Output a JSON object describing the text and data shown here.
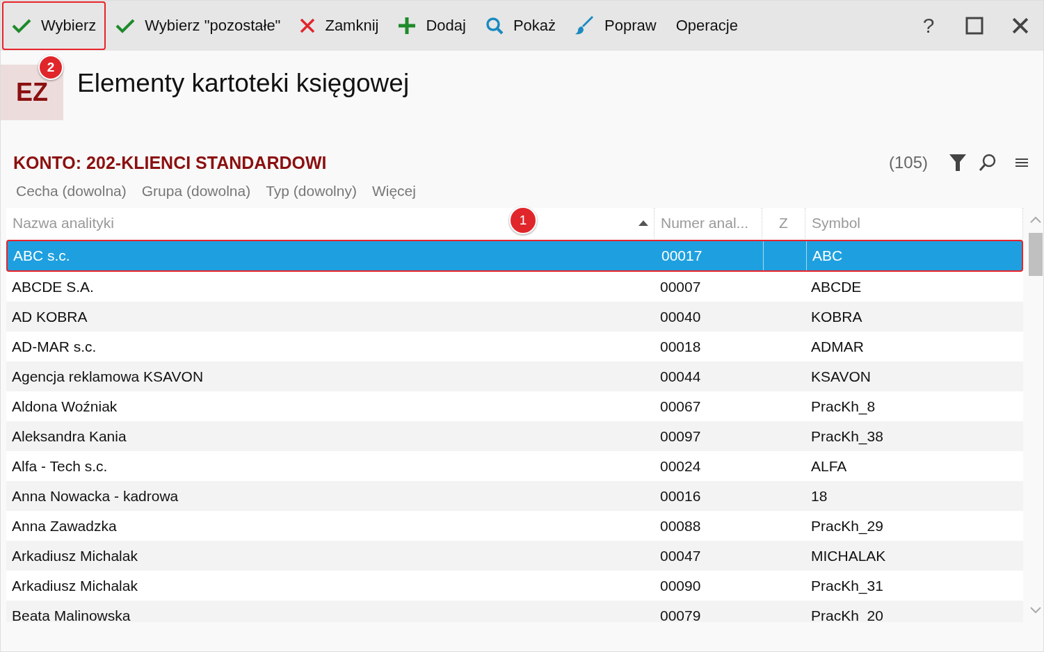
{
  "toolbar": {
    "buttons": [
      {
        "kind": "check",
        "label": "Wybierz",
        "highlighted": true
      },
      {
        "kind": "check",
        "label": "Wybierz \"pozostałe\"",
        "highlighted": false
      },
      {
        "kind": "close",
        "label": "Zamknij",
        "highlighted": false
      },
      {
        "kind": "add",
        "label": "Dodaj",
        "highlighted": false
      },
      {
        "kind": "search",
        "label": "Pokaż",
        "highlighted": false
      },
      {
        "kind": "brush",
        "label": "Popraw",
        "highlighted": false
      },
      {
        "kind": "none",
        "label": "Operacje",
        "highlighted": false
      }
    ],
    "window_controls": [
      {
        "kind": "help",
        "label": "?"
      },
      {
        "kind": "maximize"
      },
      {
        "kind": "close"
      }
    ]
  },
  "header": {
    "logo": "EZ",
    "title": "Elementy kartoteki księgowej",
    "badge": "2"
  },
  "section": {
    "heading": "KONTO: 202-KLIENCI STANDARDOWI",
    "count": "(105)",
    "filters": [
      "Cecha (dowolna)",
      "Grupa (dowolna)",
      "Typ (dowolny)",
      "Więcej"
    ]
  },
  "table": {
    "columns": [
      {
        "label": "Nazwa analityki",
        "sorted": true,
        "badge": "1"
      },
      {
        "label": "Numer anal..."
      },
      {
        "label": "Z"
      },
      {
        "label": "Symbol"
      }
    ],
    "rows": [
      {
        "cells": [
          "ABC s.c.",
          "00017",
          "",
          "ABC"
        ],
        "selected": true
      },
      {
        "cells": [
          "ABCDE S.A.",
          "00007",
          "",
          "ABCDE"
        ],
        "selected": false
      },
      {
        "cells": [
          "AD KOBRA",
          "00040",
          "",
          "KOBRA"
        ],
        "selected": false
      },
      {
        "cells": [
          "AD-MAR s.c.",
          "00018",
          "",
          "ADMAR"
        ],
        "selected": false
      },
      {
        "cells": [
          "Agencja reklamowa KSAVON",
          "00044",
          "",
          "KSAVON"
        ],
        "selected": false
      },
      {
        "cells": [
          "Aldona Woźniak",
          "00067",
          "",
          "PracKh_8"
        ],
        "selected": false
      },
      {
        "cells": [
          "Aleksandra Kania",
          "00097",
          "",
          "PracKh_38"
        ],
        "selected": false
      },
      {
        "cells": [
          "Alfa - Tech s.c.",
          "00024",
          "",
          "ALFA"
        ],
        "selected": false
      },
      {
        "cells": [
          "Anna Nowacka - kadrowa",
          "00016",
          "",
          "18"
        ],
        "selected": false
      },
      {
        "cells": [
          "Anna Zawadzka",
          "00088",
          "",
          "PracKh_29"
        ],
        "selected": false
      },
      {
        "cells": [
          "Arkadiusz Michalak",
          "00047",
          "",
          "MICHALAK"
        ],
        "selected": false
      },
      {
        "cells": [
          "Arkadiusz Michalak",
          "00090",
          "",
          "PracKh_31"
        ],
        "selected": false
      },
      {
        "cells": [
          "Beata Malinowska",
          "00079",
          "",
          "PracKh_20"
        ],
        "selected": false
      }
    ]
  }
}
